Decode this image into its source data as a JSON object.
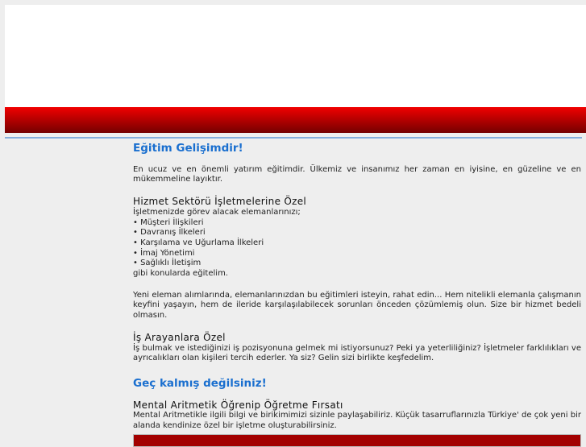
{
  "sections": {
    "h1a": "Eğitim Gelişimdir!",
    "intro": "En ucuz ve en önemli yatırım eğitimdir. Ülkemiz ve insanımız her zaman en iyisine, en güzeline ve en mükemmeline layıktır.",
    "h2a": "Hizmet Sektörü İşletmelerine Özel",
    "lead": "İşletmenizde görev alacak elemanlarınızı;",
    "items": [
      "• Müşteri İlişkileri",
      "• Davranış İlkeleri",
      "• Karşılama ve Uğurlama İlkeleri",
      "• İmaj Yönetimi",
      "• Sağlıklı İletişim"
    ],
    "tail": "gibi konularda eğitelim.",
    "para2": "Yeni eleman alımlarında, elemanlarınızdan bu eğitimleri isteyin, rahat edin... Hem nitelikli elemanla çalışmanın keyfini yaşayın, hem de ileride karşılaşılabilecek sorunları önceden çözümlemiş olun. Size bir hizmet bedeli olmasın.",
    "h2b": "İş Arayanlara Özel",
    "para3": "İş bulmak ve istediğinizi iş pozisyonuna gelmek mi istiyorsunuz? Peki ya yeterliliğiniz? İşletmeler farklılıkları ve ayrıcalıkları olan kişileri tercih ederler. Ya siz? Gelin sizi birlikte keşfedelim.",
    "h1b": "Geç kalmış değilsiniz!",
    "h2c": "Mental Aritmetik Öğrenip Öğretme Fırsatı",
    "para4": "Mental Aritmetikle ilgili bilgi ve birikimimizi sizinle paylaşabiliriz. Küçük tasarruflarınızla Türkiye' de çok yeni bir alanda kendinize özel bir işletme oluşturabilirsiniz."
  }
}
